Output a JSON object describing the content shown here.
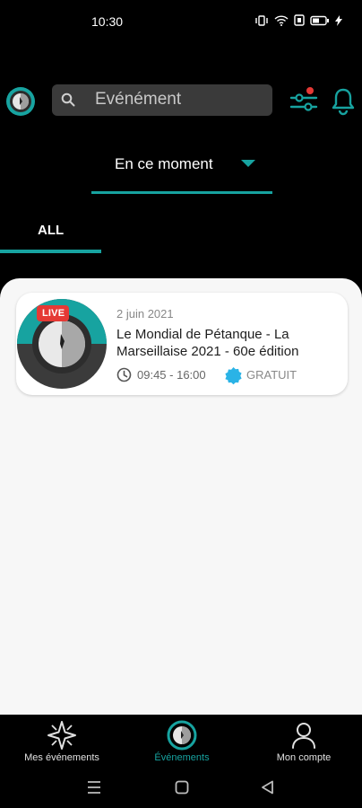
{
  "status_bar": {
    "time": "10:30"
  },
  "header": {
    "search_placeholder": "Evénément"
  },
  "period": {
    "selected": "En ce moment"
  },
  "tabs": [
    {
      "label": "ALL",
      "active": true
    }
  ],
  "events": [
    {
      "badge": "LIVE",
      "date": "2 juin 2021",
      "title": "Le Mondial de Pétanque - La Marseillaise 2021 - 60e édition",
      "time": "09:45 - 16:00",
      "price": "GRATUIT"
    }
  ],
  "bottom_nav": {
    "items": [
      {
        "label": "Mes événements",
        "icon": "sparkle-icon"
      },
      {
        "label": "Événements",
        "icon": "app-logo-icon",
        "active": true
      },
      {
        "label": "Mon compte",
        "icon": "user-icon"
      }
    ]
  },
  "colors": {
    "accent": "#17a3a0",
    "live": "#e53935",
    "background": "#000000",
    "panel": "#f7f7f7"
  }
}
